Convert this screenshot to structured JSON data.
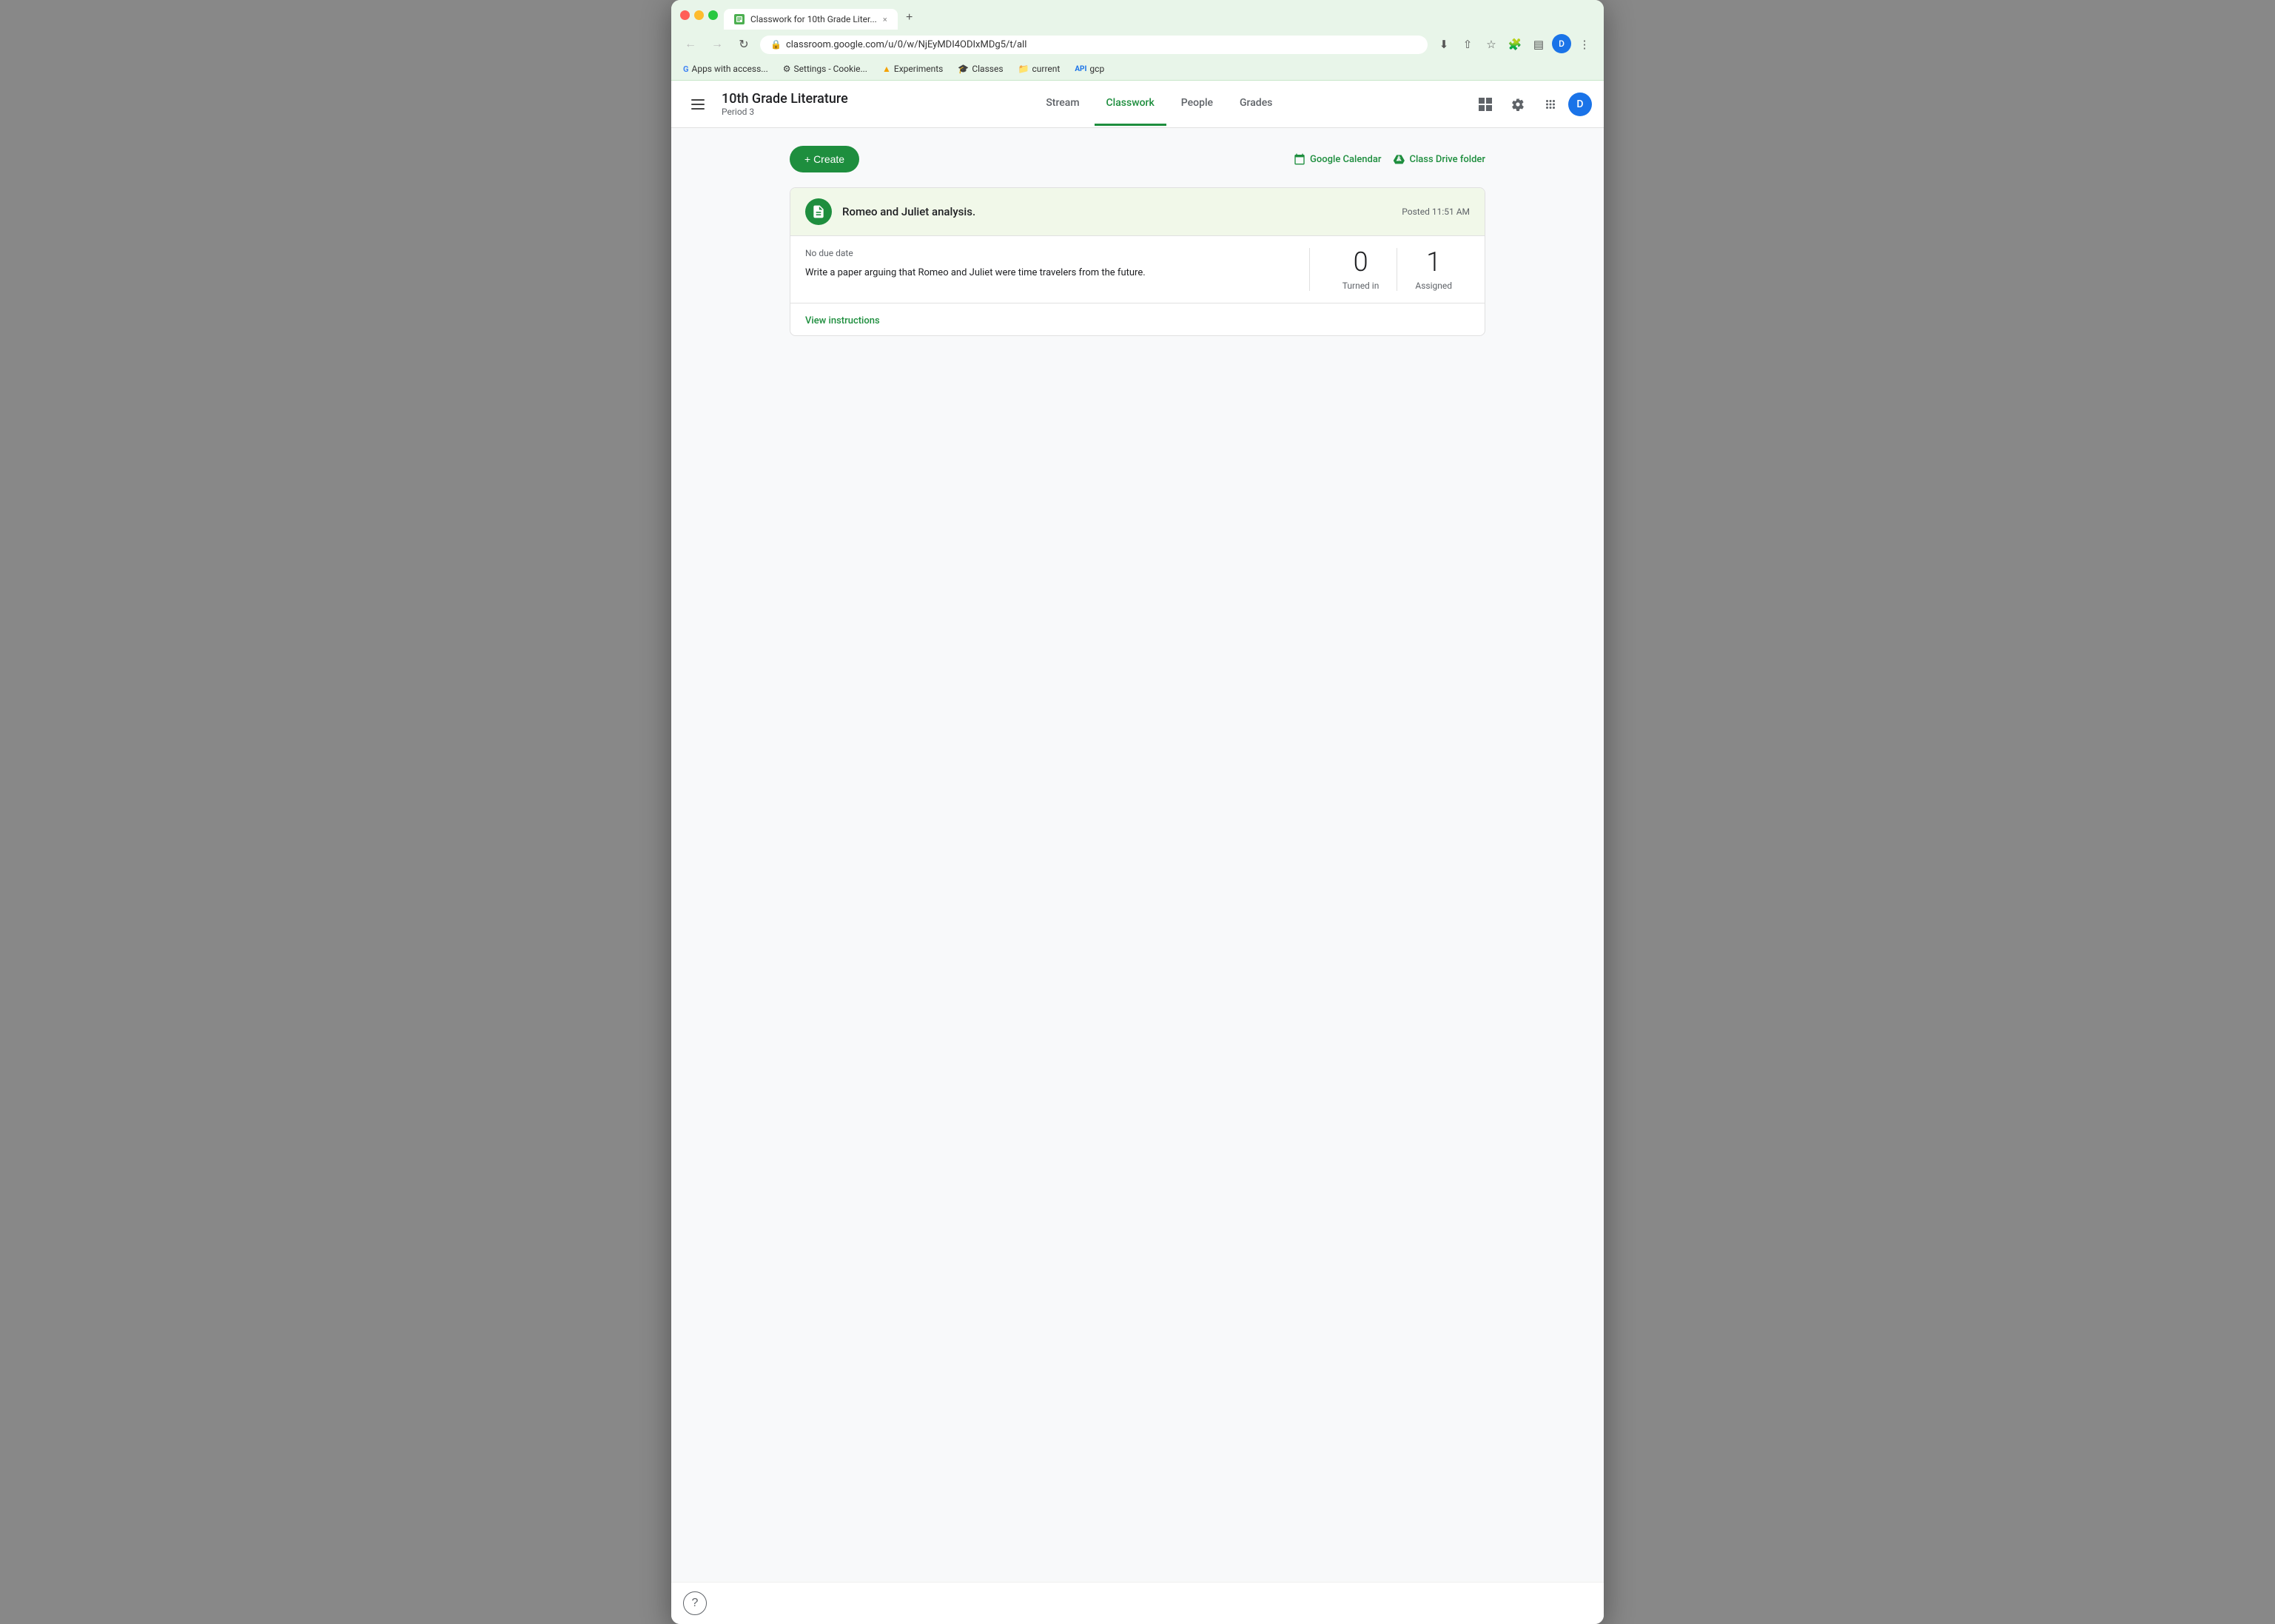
{
  "browser": {
    "tab_title": "Classwork for 10th Grade Liter...",
    "tab_close": "×",
    "url": "classroom.google.com/u/0/w/NjEyMDI4ODIxMDg5/t/all",
    "new_tab_label": "+",
    "profile_initial": "D"
  },
  "bookmarks": [
    {
      "id": "apps",
      "icon": "G",
      "label": "Apps with access..."
    },
    {
      "id": "settings",
      "icon": "⚙",
      "label": "Settings - Cookie..."
    },
    {
      "id": "experiments",
      "icon": "▲",
      "label": "Experiments"
    },
    {
      "id": "classes",
      "icon": "🎓",
      "label": "Classes"
    },
    {
      "id": "current",
      "icon": "📁",
      "label": "current"
    },
    {
      "id": "gcp",
      "icon": "API",
      "label": "gcp"
    }
  ],
  "header": {
    "class_title": "10th Grade Literature",
    "class_period": "Period 3",
    "nav_tabs": [
      {
        "id": "stream",
        "label": "Stream",
        "active": false
      },
      {
        "id": "classwork",
        "label": "Classwork",
        "active": true
      },
      {
        "id": "people",
        "label": "People",
        "active": false
      },
      {
        "id": "grades",
        "label": "Grades",
        "active": false
      }
    ],
    "profile_initial": "D"
  },
  "toolbar": {
    "create_label": "+ Create",
    "google_calendar_label": "Google Calendar",
    "class_drive_label": "Class Drive folder"
  },
  "assignment": {
    "title": "Romeo and Juliet analysis.",
    "posted": "Posted 11:51 AM",
    "due_date": "No due date",
    "description": "Write a paper arguing that Romeo and Juliet were time travelers from the future.",
    "turned_in_count": "0",
    "turned_in_label": "Turned in",
    "assigned_count": "1",
    "assigned_label": "Assigned",
    "view_instructions_label": "View instructions"
  },
  "help": {
    "icon": "?"
  }
}
